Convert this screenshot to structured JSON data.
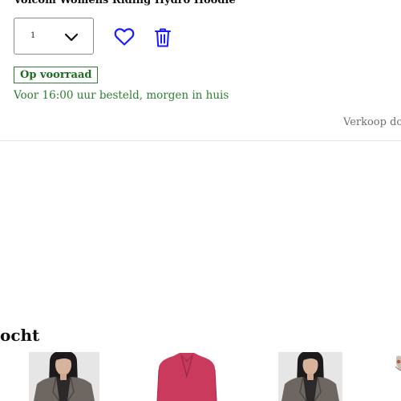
{
  "cart_item": {
    "product_name": "Volcom Womens Riding Hydro Hoodie",
    "quantity": "1",
    "stock_status": "Op voorraad",
    "delivery_info": "Voor 16:00 uur besteld, morgen in huis",
    "seller_text": "Verkoop do"
  },
  "recommendations": {
    "heading": "ocht",
    "items": [
      {
        "image": "woman-grey-leather-jacket"
      },
      {
        "image": "pink-blazer"
      },
      {
        "image": "woman-grey-leather-jacket"
      },
      {
        "image": "product-partial"
      }
    ]
  },
  "colors": {
    "accent_blue": "#1a1aff",
    "stock_green": "#2e7d32",
    "divider": "#e4e4e4"
  },
  "icons": {
    "quantity_dropdown": "chevron-down-icon",
    "wishlist": "heart-icon",
    "delete": "trash-icon"
  }
}
